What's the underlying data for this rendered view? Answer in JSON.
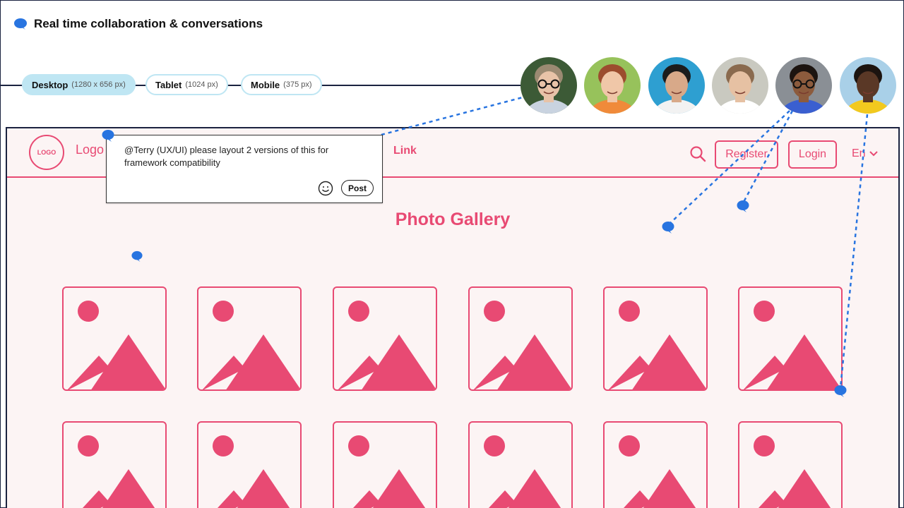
{
  "header": {
    "title": "Real time collaboration & conversations",
    "icon": "speech-bubble-icon"
  },
  "viewports": [
    {
      "label": "Desktop",
      "dims": "(1280 x 656 px)",
      "active": true
    },
    {
      "label": "Tablet",
      "dims": "(1024 px)",
      "active": false
    },
    {
      "label": "Mobile",
      "dims": "(375 px)",
      "active": false
    }
  ],
  "collaborators": [
    {
      "name": "collaborator-1",
      "skin": "#e8c3a8",
      "hair": "#9b8a72",
      "bg": "#3c5a36",
      "shirt": "#c9d3e0",
      "glasses": true
    },
    {
      "name": "collaborator-2",
      "skin": "#f0c7a8",
      "hair": "#9c4d2e",
      "bg": "#97c25b",
      "shirt": "#f08a3a",
      "glasses": false
    },
    {
      "name": "collaborator-3",
      "skin": "#d8a989",
      "hair": "#1c1c1c",
      "bg": "#2e9fd1",
      "shirt": "#f2f2f2",
      "glasses": false
    },
    {
      "name": "collaborator-4",
      "skin": "#e6c1a3",
      "hair": "#8a6a4e",
      "bg": "#c9c9c0",
      "shirt": "#ffffff",
      "glasses": false
    },
    {
      "name": "collaborator-5",
      "skin": "#8c5b3d",
      "hair": "#1c1410",
      "bg": "#8a8f95",
      "shirt": "#3a5fd0",
      "glasses": true
    },
    {
      "name": "collaborator-6",
      "skin": "#5a3826",
      "hair": "#1c1410",
      "bg": "#a9d0e8",
      "shirt": "#f2c91e",
      "glasses": false
    }
  ],
  "site": {
    "logo_circle": "LOGO",
    "logo_text": "Logo",
    "link": "Link",
    "search_icon": "search-icon",
    "register": "Register",
    "login": "Login",
    "language": "En"
  },
  "gallery": {
    "title": "Photo Gallery",
    "placeholder_icon": "image-placeholder-icon",
    "rows": 2,
    "cols": 6
  },
  "comment": {
    "text": "@Terry (UX/UI) please layout 2 versions of this for framework compatibility",
    "emoji_icon": "smiley-icon",
    "post": "Post"
  },
  "colors": {
    "accent": "#e84a73",
    "pin": "#2874e0",
    "pill": "#bfe6f3",
    "canvas": "#fcf4f4",
    "frame": "#1b2340"
  }
}
